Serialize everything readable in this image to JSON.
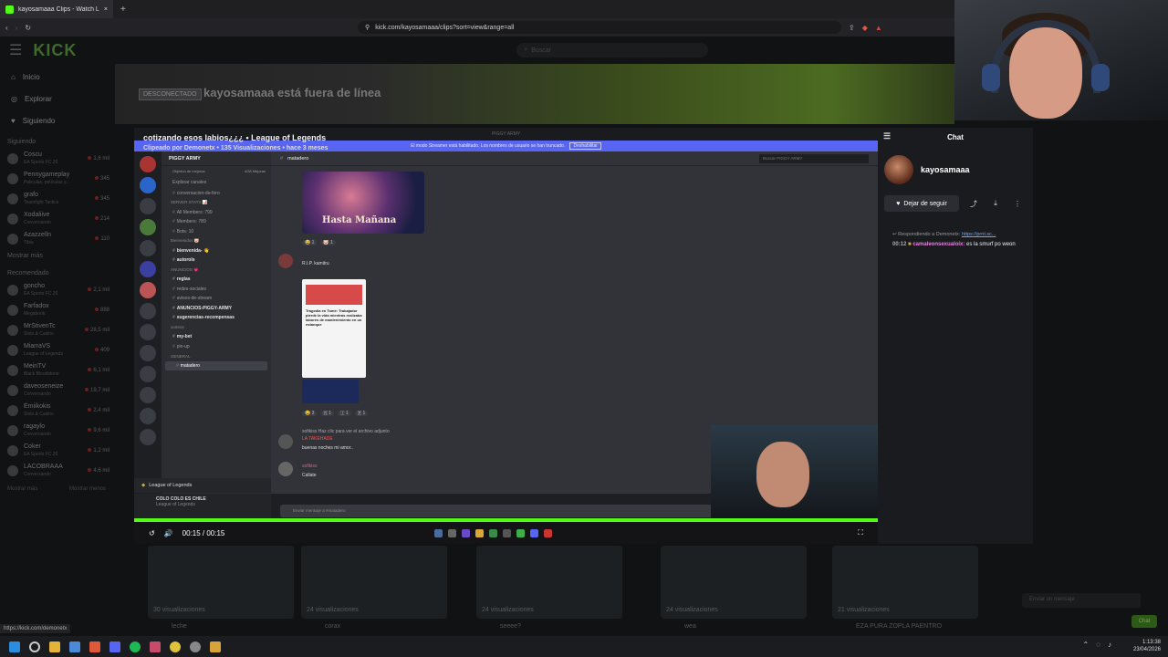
{
  "browser": {
    "tab_title": "kayosamaaa Clips - Watch Li...",
    "url": "kick.com/kayosamaaa/clips?sort=view&range=all",
    "new_tab": "+",
    "close_tab": "×"
  },
  "kick": {
    "logo": "KICK",
    "search_placeholder": "Buscar",
    "nav": [
      "Inicio",
      "Explorar",
      "Siguiendo"
    ],
    "following_title": "Siguiendo",
    "following": [
      {
        "name": "Coscu",
        "sub": "EA Sports FC 26",
        "count": "1,6 mil"
      },
      {
        "name": "Pennygameplay",
        "sub": "Peliculas, películas y...",
        "count": "345"
      },
      {
        "name": "grafo",
        "sub": "Teamfight Tactics",
        "count": "345"
      },
      {
        "name": "Xodaliive",
        "sub": "Conversando",
        "count": "214"
      },
      {
        "name": "Azazzelln",
        "sub": "Tibia",
        "count": "110"
      }
    ],
    "show_more": "Mostrar más",
    "recommended_title": "Recomendado",
    "recommended": [
      {
        "name": "goncho",
        "sub": "EA Sports FC 26",
        "count": "2,1 mil"
      },
      {
        "name": "Farfadox",
        "sub": "Megabonk",
        "count": "888"
      },
      {
        "name": "MrStivenTc",
        "sub": "Slots & Casino",
        "count": "28,5 mil"
      },
      {
        "name": "MiarraVS",
        "sub": "League of Legends",
        "count": "409"
      },
      {
        "name": "MeinTV",
        "sub": "Black Bloodstone",
        "count": "6,1 mil"
      },
      {
        "name": "daveoseneize",
        "sub": "Conversando",
        "count": "19,7 mil"
      },
      {
        "name": "Emiikokis",
        "sub": "Slots & Casino",
        "count": "2,4 mil"
      },
      {
        "name": "ragaylo",
        "sub": "Conversando",
        "count": "9,6 mil"
      },
      {
        "name": "Coker",
        "sub": "EA Sports FC 26",
        "count": "1,2 mil"
      },
      {
        "name": "LACOBRAAA",
        "sub": "Conversando",
        "count": "4,6 mil"
      }
    ],
    "show_more2": "Mostrar más",
    "show_less": "Mostrar menos",
    "offline_badge": "DESCONECTADO",
    "offline_text": "kayosamaaa está fuera de línea"
  },
  "clip": {
    "title": "cotizando esos labios¿¿¿ • League of Legends",
    "subtitle": "Clipeado por Demonetx • 135 Visualizaciones • hace 3 meses",
    "time": "00:15 / 00:15"
  },
  "discord": {
    "window_title": "PIGGY ARMY",
    "banner": "El modo Streamer está habilitado. Los nombres de usuario se han truncado.",
    "banner_button": "Deshabilitar",
    "server_name": "PIGGY ARMY",
    "boost": "Objetivo de mejoras",
    "boost_count": "4/28 Mejoras",
    "explore": "Explorar canales",
    "channels": [
      {
        "label": "conversacion-de-foro",
        "cls": ""
      },
      {
        "label": "SERVER STATS 📊",
        "cls": "cat"
      },
      {
        "label": "All Members: 799",
        "cls": ""
      },
      {
        "label": "Members: 789",
        "cls": ""
      },
      {
        "label": "Bots: 10",
        "cls": ""
      },
      {
        "label": "Bienvenidos 🐷",
        "cls": "cat"
      },
      {
        "label": "bienvenida- 👋",
        "cls": "bold"
      },
      {
        "label": "autorols",
        "cls": "bold"
      },
      {
        "label": "ANUNCIOS 💗",
        "cls": "cat"
      },
      {
        "label": "reglas",
        "cls": "bold"
      },
      {
        "label": "redes-sociales",
        "cls": ""
      },
      {
        "label": "avisos-de-stream",
        "cls": ""
      },
      {
        "label": "ANUNCIOS-PIGGY-ARMY",
        "cls": "bold"
      },
      {
        "label": "sugerencias-recompensas",
        "cls": "bold"
      },
      {
        "label": "sorteos",
        "cls": "cat"
      },
      {
        "label": "my-bet",
        "cls": "bold"
      },
      {
        "label": "pin-up",
        "cls": ""
      },
      {
        "label": "GENERAL",
        "cls": "cat"
      },
      {
        "label": "matadero",
        "cls": "sel"
      }
    ],
    "voice_label": "League of Legends",
    "user_name": "COLO COLO ES CHILE",
    "user_status": "League of Legends",
    "current_channel": "matadero",
    "search_placeholder": "Buscar PIGGY ARMY",
    "image1_text": "Hasta Mañana",
    "msg1_author": "R.I.P. kamitru",
    "article_title": "Tragedia en Tomé: Trabajador pierde la vida mientras realizaba labores de mantenimiento en un estanque",
    "attachment_note": "sofikiss Haz clic para ver el archivo adjunto",
    "msg2_author": "LA TAKEHADE",
    "msg2_text": "buenas noches mi amor..",
    "msg3_author": "sofikiss",
    "msg3_text": "Callate",
    "input_placeholder": "Enviar mensaje a #matadero"
  },
  "side_chat": {
    "title": "Chat",
    "channel_name": "kayosamaaa",
    "follow_label": "Dejar de seguir",
    "reply_prefix": "Respondiendo a Demonetx:",
    "reply_link": "https://prnt.sc...",
    "msg_time": "00:12",
    "msg_user": "camaleonsexualoix:",
    "msg_text": "es la smurf po weon"
  },
  "thumbs": [
    {
      "views": "30 visualizaciones",
      "title": "leche"
    },
    {
      "views": "24 visualizaciones",
      "title": "corax"
    },
    {
      "views": "24 visualizaciones",
      "title": "seeee?"
    },
    {
      "views": "24 visualizaciones",
      "title": "wea"
    },
    {
      "views": "21 visualizaciones",
      "title": "EZA PURA ZOPLA PAENTRO"
    }
  ],
  "bottom_chat_placeholder": "Enviar un mensaje",
  "bottom_chat_button": "Chat",
  "status_url": "https://kick.com/demonetx",
  "taskbar": {
    "time": "1:13:38",
    "date": "23/04/2026"
  },
  "colors": {
    "kick_green": "#53fc18",
    "discord_blurple": "#5865f2"
  }
}
